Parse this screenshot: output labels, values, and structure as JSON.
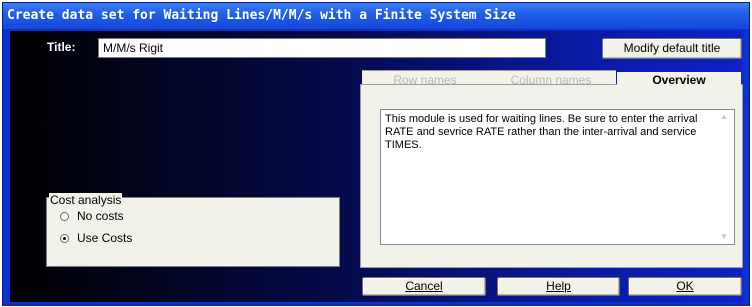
{
  "window": {
    "title": "Create data set for Waiting Lines/M/M/s with a Finite System Size"
  },
  "title_row": {
    "label": "Title:",
    "value": "M/M/s Rigit",
    "modify_button": "Modify default title"
  },
  "tabs": [
    {
      "label": "Row names",
      "active": false
    },
    {
      "label": "Column names",
      "active": false
    },
    {
      "label": "Overview",
      "active": true
    }
  ],
  "overview": {
    "text": "This module is used for waiting lines. Be sure to enter the arrival RATE and sevrice RATE rather than the inter-arrival and service TIMES."
  },
  "cost_analysis": {
    "title": "Cost analysis",
    "options": [
      {
        "label": "No costs",
        "selected": false
      },
      {
        "label": "Use Costs",
        "selected": true
      }
    ]
  },
  "buttons": {
    "cancel": "Cancel",
    "help": "Help",
    "ok": "OK"
  },
  "colors": {
    "titlebar": "#1f5de6",
    "client_dark": "#000000",
    "client_light": "#0d22c8",
    "panel": "#f2f1ea"
  }
}
